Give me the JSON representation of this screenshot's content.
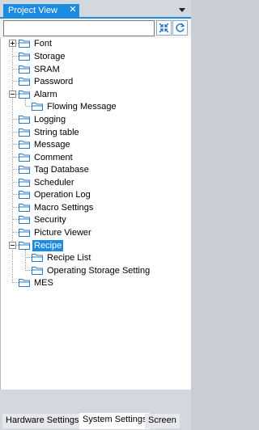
{
  "panel": {
    "title": "Project View",
    "close_glyph": "✕"
  },
  "toolbar": {
    "search_value": "",
    "collapse_icon": "collapse-all-icon",
    "refresh_icon": "refresh-icon"
  },
  "tree": {
    "items": [
      {
        "label": "Font"
      },
      {
        "label": "Storage"
      },
      {
        "label": "SRAM"
      },
      {
        "label": "Password"
      },
      {
        "label": "Alarm"
      },
      {
        "label": "Flowing Message"
      },
      {
        "label": "Logging"
      },
      {
        "label": "String table"
      },
      {
        "label": "Message"
      },
      {
        "label": "Comment"
      },
      {
        "label": "Tag Database"
      },
      {
        "label": "Scheduler"
      },
      {
        "label": "Operation Log"
      },
      {
        "label": "Macro Settings"
      },
      {
        "label": "Security"
      },
      {
        "label": "Picture Viewer"
      },
      {
        "label": "Recipe"
      },
      {
        "label": "Recipe List"
      },
      {
        "label": "Operating Storage Setting"
      },
      {
        "label": "MES"
      }
    ]
  },
  "bottom_tabs": [
    {
      "label": "Hardware Settings"
    },
    {
      "label": "System Settings"
    },
    {
      "label": "Screen"
    }
  ],
  "colors": {
    "accent": "#1c8ce0",
    "folder": "#2a7bc8"
  }
}
